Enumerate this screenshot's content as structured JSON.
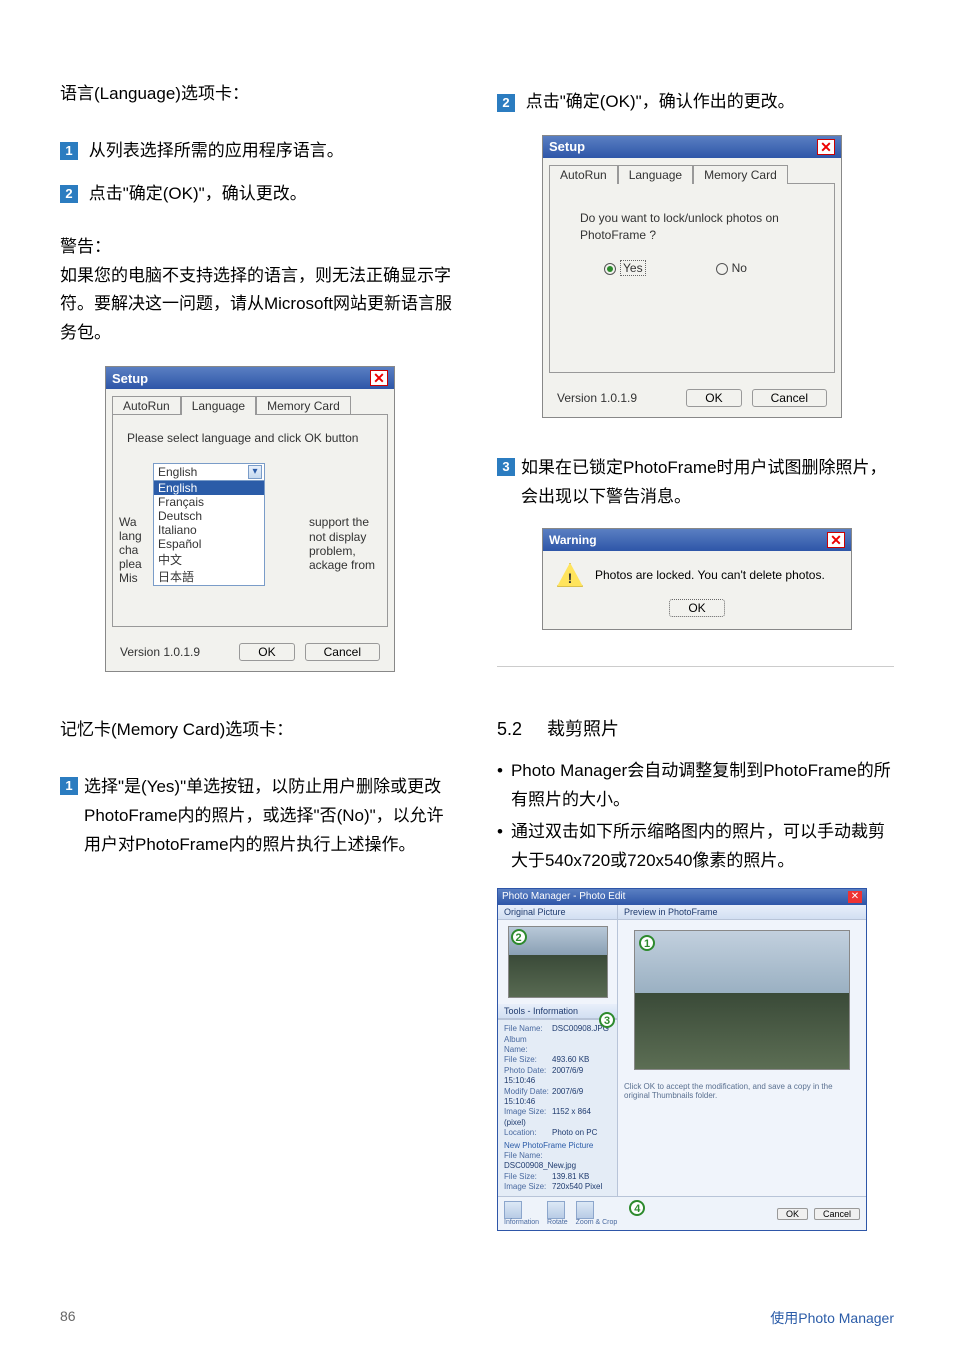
{
  "left": {
    "language_tab_line": "语言(Language)选项卡：",
    "step1": "从列表选择所需的应用程序语言。",
    "step2": "点击\"确定(OK)\"，确认更改。",
    "warn_label": "警告：",
    "warn_body1": "如果您的电脑不支持选择的语言，则无法正确显示字符。要解决这一问题，请从Microsoft网站更新语言服务包。",
    "setup": {
      "title": "Setup",
      "tabs": [
        "AutoRun",
        "Language",
        "Memory Card"
      ],
      "lang_prompt": "Please select language and click OK button",
      "selected": "English",
      "options": [
        "English",
        "Français",
        "Deutsch",
        "Italiano",
        "Español",
        "中文",
        "日本語"
      ],
      "side_prefix": [
        "Wa",
        "lang",
        "cha",
        "plea",
        "Mis"
      ],
      "side_note": [
        "support the",
        "not display",
        "problem,",
        "ackage from"
      ],
      "version": "Version 1.0.1.9",
      "ok": "OK",
      "cancel": "Cancel"
    },
    "memcard_line": "记忆卡(Memory Card)选项卡：",
    "memcard_step1": "选择\"是(Yes)\"单选按钮，以防止用户删除或更改PhotoFrame内的照片，或选择\"否(No)\"，以允许用户对PhotoFrame内的照片执行上述操作。"
  },
  "right": {
    "step2": "点击\"确定(OK)\"，确认作出的更改。",
    "memcard_dialog": {
      "title": "Setup",
      "tabs": [
        "AutoRun",
        "Language",
        "Memory Card"
      ],
      "question": "Do you want to lock/unlock photos on PhotoFrame ?",
      "yes": "Yes",
      "no": "No",
      "version": "Version 1.0.1.9",
      "ok": "OK",
      "cancel": "Cancel"
    },
    "step3": "如果在已锁定PhotoFrame时用户试图删除照片，会出现以下警告消息。",
    "warn_dialog": {
      "title": "Warning",
      "msg": "Photos are locked. You can't delete photos.",
      "ok": "OK"
    },
    "sec52_num": "5.2",
    "sec52_title": "裁剪照片",
    "bullets": [
      "Photo Manager会自动调整复制到PhotoFrame的所有照片的大小。",
      "通过双击如下所示缩略图内的照片，可以手动裁剪大于540x720或720x540像素的照片。"
    ],
    "pm": {
      "title": "Photo Manager - Photo Edit",
      "original": "Original Picture",
      "preview": "Preview in PhotoFrame",
      "tools_info": "Tools - Information",
      "info": {
        "FileName": "DSC00908.JPG",
        "AlbumName": "",
        "FileSize": "493.60 KB",
        "PhotoDate": "2007/6/9 15:10:46",
        "ModifyDate": "2007/6/9 15:10:46",
        "ImageSize": "1152 x 864 (pixel)",
        "Location": "Photo on PC"
      },
      "new_header": "New PhotoFrame Picture",
      "new_info": {
        "FileName": "DSC00908_New.jpg",
        "FileSize": "139.81 KB",
        "ImageSize": "720x540 Pixel"
      },
      "note": "Click OK to accept the modification, and save a copy in the original Thumbnails folder.",
      "tool_labels": [
        "Information",
        "Rotate",
        "Zoom & Crop"
      ],
      "ok": "OK",
      "cancel": "Cancel"
    }
  },
  "footer": {
    "page": "86",
    "label": "使用Photo Manager"
  }
}
